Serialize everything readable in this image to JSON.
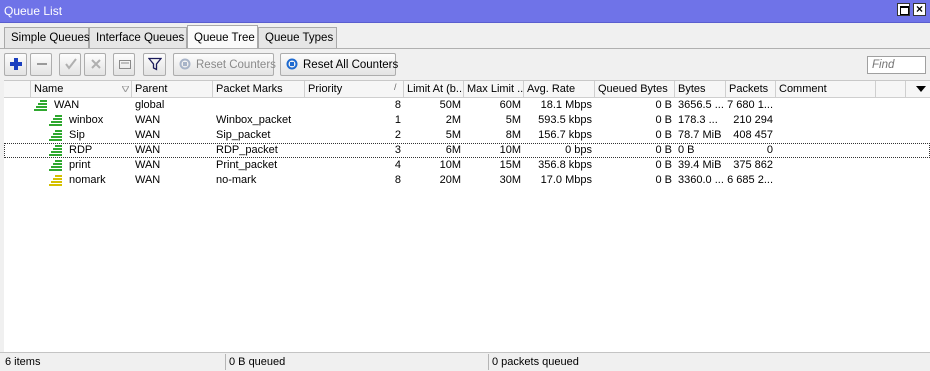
{
  "window": {
    "title": "Queue List"
  },
  "tabs": [
    {
      "label": "Simple Queues"
    },
    {
      "label": "Interface Queues"
    },
    {
      "label": "Queue Tree"
    },
    {
      "label": "Queue Types"
    }
  ],
  "toolbar": {
    "reset_counters": "Reset Counters",
    "reset_all_counters": "Reset All Counters",
    "find_placeholder": "Find"
  },
  "columns": [
    "Name",
    "Parent",
    "Packet Marks",
    "Priority",
    "Limit At (b...",
    "Max Limit ...",
    "Avg. Rate",
    "Queued Bytes",
    "Bytes",
    "Packets",
    "Comment"
  ],
  "rows": [
    {
      "name": "WAN",
      "parent": "global",
      "marks": "",
      "priority": "8",
      "limit_at": "50M",
      "max_limit": "60M",
      "avg_rate": "18.1 Mbps",
      "queued_bytes": "0 B",
      "bytes": "3656.5 ...",
      "packets": "7 680 1...",
      "comment": "",
      "icon": "queue-green-icon"
    },
    {
      "name": "winbox",
      "parent": "WAN",
      "marks": "Winbox_packet",
      "priority": "1",
      "limit_at": "2M",
      "max_limit": "5M",
      "avg_rate": "593.5 kbps",
      "queued_bytes": "0 B",
      "bytes": "178.3 ...",
      "packets": "210 294",
      "comment": "",
      "icon": "queue-green-icon"
    },
    {
      "name": "Sip",
      "parent": "WAN",
      "marks": "Sip_packet",
      "priority": "2",
      "limit_at": "5M",
      "max_limit": "8M",
      "avg_rate": "156.7 kbps",
      "queued_bytes": "0 B",
      "bytes": "78.7 MiB",
      "packets": "408 457",
      "comment": "",
      "icon": "queue-green-icon"
    },
    {
      "name": "RDP",
      "parent": "WAN",
      "marks": "RDP_packet",
      "priority": "3",
      "limit_at": "6M",
      "max_limit": "10M",
      "avg_rate": "0 bps",
      "queued_bytes": "0 B",
      "bytes": "0 B",
      "packets": "0",
      "comment": "",
      "icon": "queue-green-icon"
    },
    {
      "name": "print",
      "parent": "WAN",
      "marks": "Print_packet",
      "priority": "4",
      "limit_at": "10M",
      "max_limit": "15M",
      "avg_rate": "356.8 kbps",
      "queued_bytes": "0 B",
      "bytes": "39.4 MiB",
      "packets": "375 862",
      "comment": "",
      "icon": "queue-green-icon"
    },
    {
      "name": "nomark",
      "parent": "WAN",
      "marks": "no-mark",
      "priority": "8",
      "limit_at": "20M",
      "max_limit": "30M",
      "avg_rate": "17.0 Mbps",
      "queued_bytes": "0 B",
      "bytes": "3360.0 ...",
      "packets": "6 685 2...",
      "comment": "",
      "icon": "queue-yellow-icon"
    }
  ],
  "status": {
    "items": "6 items",
    "queued_bytes": "0 B queued",
    "queued_packets": "0 packets queued"
  },
  "colors": {
    "titlebar": "#6f73e8",
    "queue_green": "#2fa82f",
    "queue_yellow": "#d4c000",
    "add_blue": "#1a3fbf"
  }
}
